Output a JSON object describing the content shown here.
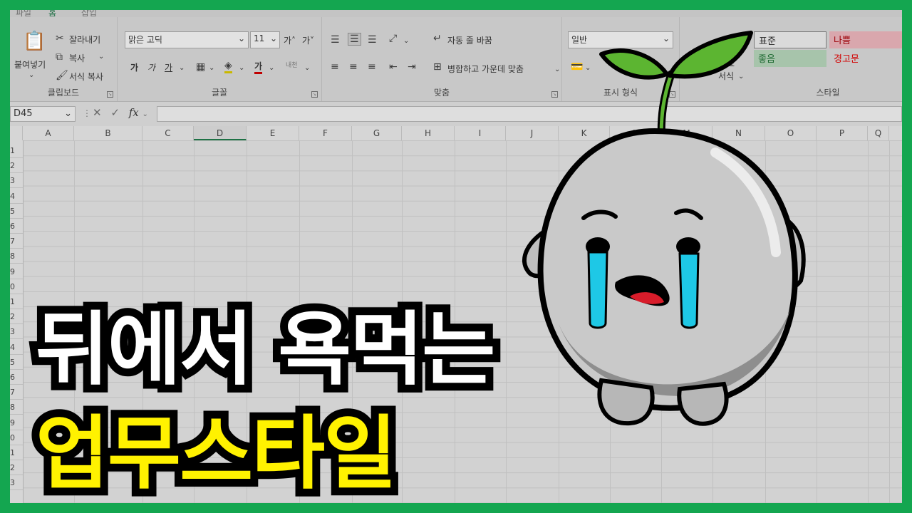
{
  "ribbon": {
    "clipboard": {
      "paste_label": "붙여넣기",
      "cut_label": "잘라내기",
      "copy_label": "복사",
      "format_painter_label": "서식 복사",
      "group_label": "클립보드"
    },
    "font": {
      "font_name": "맑은 고딕",
      "font_size": "11",
      "bold": "가",
      "italic": "가",
      "underline": "가",
      "font_color_glyph": "가",
      "phonetic": "내천",
      "grow": "가˄",
      "shrink": "가˅",
      "group_label": "글꼴"
    },
    "alignment": {
      "wrap_text_label": "자동 줄 바꿈",
      "merge_label": "병합하고 가운데 맞춤",
      "group_label": "맞춤"
    },
    "number": {
      "format_value": "일반",
      "group_label": "표시 형식"
    },
    "styles": {
      "conditional_label": "표",
      "format_label": "서식",
      "normal": "표준",
      "bad": "나쁨",
      "good": "좋음",
      "warning": "경고문",
      "group_label": "스타일"
    }
  },
  "formula_bar": {
    "name_box": "D45"
  },
  "grid": {
    "columns": [
      "A",
      "B",
      "C",
      "D",
      "E",
      "F",
      "G",
      "H",
      "I",
      "J",
      "K",
      "L",
      "M",
      "N",
      "O",
      "P",
      "Q"
    ],
    "selected_column": "D",
    "row_labels": [
      "1",
      "2",
      "3",
      "4",
      "5",
      "6",
      "7",
      "8",
      "9",
      "0",
      "1",
      "2",
      "3",
      "4",
      "5",
      "6",
      "7",
      "8",
      "9",
      "0",
      "1",
      "2",
      "3"
    ]
  },
  "headline": {
    "line1": "뒤에서 욕먹는",
    "line2": "업무스타일"
  },
  "colors": {
    "frame": "#14a650",
    "headline_line1": "#ffffff",
    "headline_line2": "#fff200",
    "sprout": "#5cb531",
    "tears": "#1ec8e6"
  }
}
